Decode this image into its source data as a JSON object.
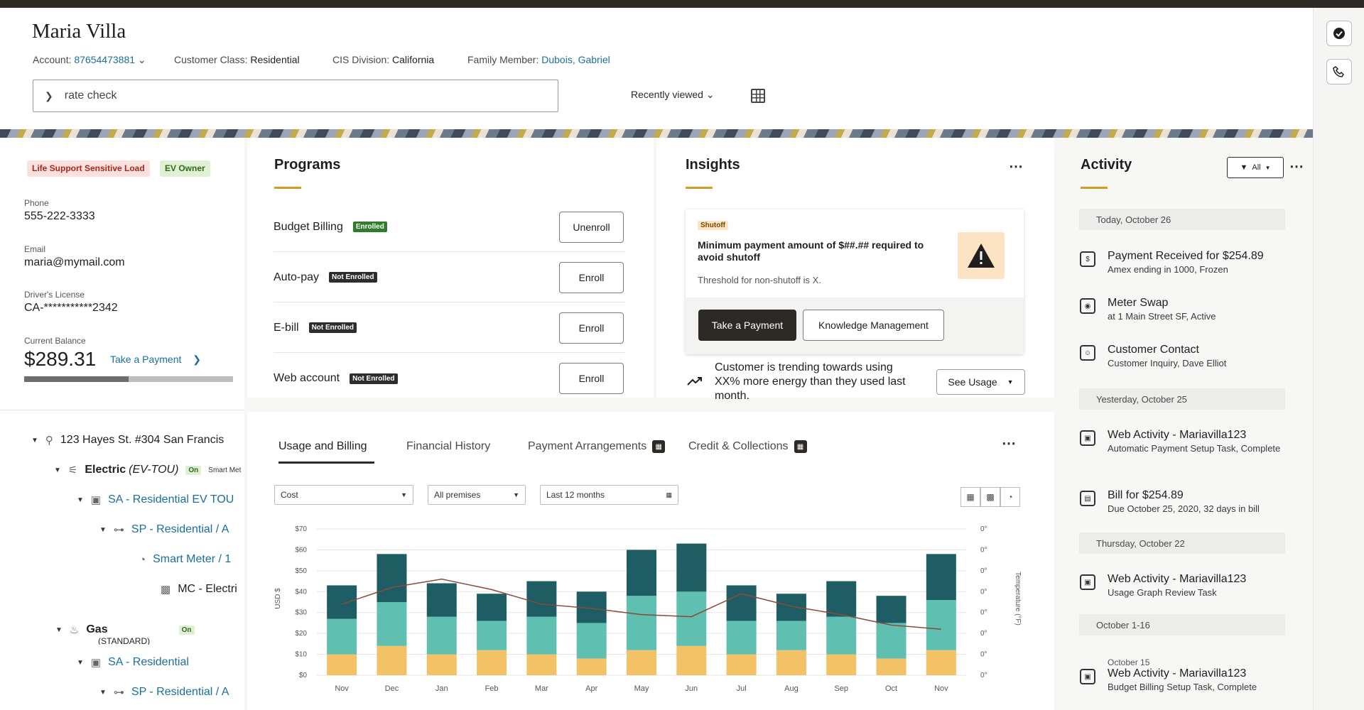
{
  "header": {
    "name": "Maria Villa",
    "account_label": "Account:",
    "account_value": "87654473881",
    "class_label": "Customer Class:",
    "class_value": "Residential",
    "division_label": "CIS Division:",
    "division_value": "California",
    "family_label": "Family Member:",
    "family_value": "Dubois, Gabriel",
    "search_value": "rate check",
    "recently_viewed": "Recently viewed"
  },
  "customer": {
    "chip_life_support": "Life Support Sensitive Load",
    "chip_ev": "EV Owner",
    "phone_label": "Phone",
    "phone": "555-222-3333",
    "email_label": "Email",
    "email": "maria@mymail.com",
    "license_label": "Driver's License",
    "license": "CA-***********2342",
    "balance_label": "Current Balance",
    "balance": "$289.31",
    "take_payment": "Take a Payment",
    "balance_progress": 0.5
  },
  "tree": {
    "address": "123 Hayes St. #304 San Francis",
    "electric": "Electric",
    "electric_rate": "(EV-TOU)",
    "electric_on": "On",
    "smart_meter_tag": "Smart Met",
    "sa_residential_ev": "SA - Residential EV TOU",
    "sp_residential_a": "SP - Residential / A",
    "smart_meter": "Smart Meter / 1",
    "mc_electric": "MC - Electri",
    "gas": "Gas",
    "gas_sub": "(STANDARD)",
    "gas_on": "On",
    "sa_residential": "SA - Residential",
    "sp_residential_a2": "SP - Residential / A"
  },
  "programs": {
    "title": "Programs",
    "items": [
      {
        "name": "Budget Billing",
        "status": "Enrolled",
        "action": "Unenroll"
      },
      {
        "name": "Auto-pay",
        "status": "Not Enrolled",
        "action": "Enroll"
      },
      {
        "name": "E-bill",
        "status": "Not Enrolled",
        "action": "Enroll"
      },
      {
        "name": "Web account",
        "status": "Not Enrolled",
        "action": "Enroll"
      }
    ]
  },
  "insights": {
    "title": "Insights",
    "tag": "Shutoff",
    "message": "Minimum payment amount of $##.## required to avoid shutoff",
    "threshold": "Threshold for non-shutoff is X.",
    "btn_payment": "Take a Payment",
    "btn_knowledge": "Knowledge Management",
    "trend_text": "Customer is trending towards using XX% more energy than they used last month.",
    "see_usage": "See Usage"
  },
  "tabs": {
    "usage": "Usage and Billing",
    "financial": "Financial History",
    "payment": "Payment Arrangements",
    "credit": "Credit & Collections"
  },
  "filters": {
    "cost": "Cost",
    "premises": "All premises",
    "period": "Last 12 months"
  },
  "chart_data": {
    "type": "bar",
    "ylabel": "USD $",
    "y2label": "Temperature (°F)",
    "ylim": [
      0,
      70
    ],
    "yticks": [
      "$0",
      "$10",
      "$20",
      "$30",
      "$40",
      "$50",
      "$60",
      "$70"
    ],
    "y2ticks": [
      "0°",
      "0°",
      "0°",
      "0°",
      "0°",
      "0°",
      "0°",
      "0°"
    ],
    "categories": [
      "Nov",
      "Dec",
      "Jan",
      "Feb",
      "Mar",
      "Apr",
      "May",
      "Jun",
      "Jul",
      "Aug",
      "Sep",
      "Oct",
      "Nov"
    ],
    "stacked": true,
    "series": [
      {
        "color": "#f3c266",
        "values": [
          10,
          14,
          10,
          12,
          10,
          8,
          12,
          14,
          10,
          12,
          10,
          8,
          12
        ]
      },
      {
        "color": "#5fbfb1",
        "values": [
          17,
          21,
          18,
          14,
          18,
          17,
          26,
          26,
          16,
          14,
          18,
          17,
          24
        ]
      },
      {
        "color": "#1e5d63",
        "values": [
          16,
          23,
          16,
          13,
          17,
          15,
          22,
          23,
          17,
          13,
          17,
          13,
          22
        ]
      }
    ],
    "line": {
      "color": "#8a4a3a",
      "values": [
        34,
        42,
        46,
        41,
        34,
        32,
        29,
        28,
        39,
        33,
        29,
        24,
        22
      ]
    }
  },
  "activity": {
    "title": "Activity",
    "filter": "All",
    "groups": [
      {
        "date": "Today, October 26"
      },
      {
        "date": "Yesterday, October 25"
      },
      {
        "date": "Thursday, October 22"
      },
      {
        "date": "October 1-16"
      }
    ],
    "items": [
      {
        "title": "Payment Received for $254.89",
        "sub": "Amex ending in 1000, Frozen"
      },
      {
        "title": "Meter Swap",
        "sub": "at 1 Main Street SF, Active"
      },
      {
        "title": "Customer Contact",
        "sub": "Customer Inquiry, Dave Elliot"
      },
      {
        "title": "Web Activity - Mariavilla123",
        "sub": "Automatic Payment Setup Task, Complete"
      },
      {
        "title": "Bill for $254.89",
        "sub": "Due October 25, 2020, 32 days in bill"
      },
      {
        "title": "Web Activity - Mariavilla123",
        "sub": "Usage Graph Review Task"
      },
      {
        "pre": "October 15",
        "title": "Web Activity - Mariavilla123",
        "sub": "Budget Billing Setup Task, Complete"
      }
    ]
  }
}
